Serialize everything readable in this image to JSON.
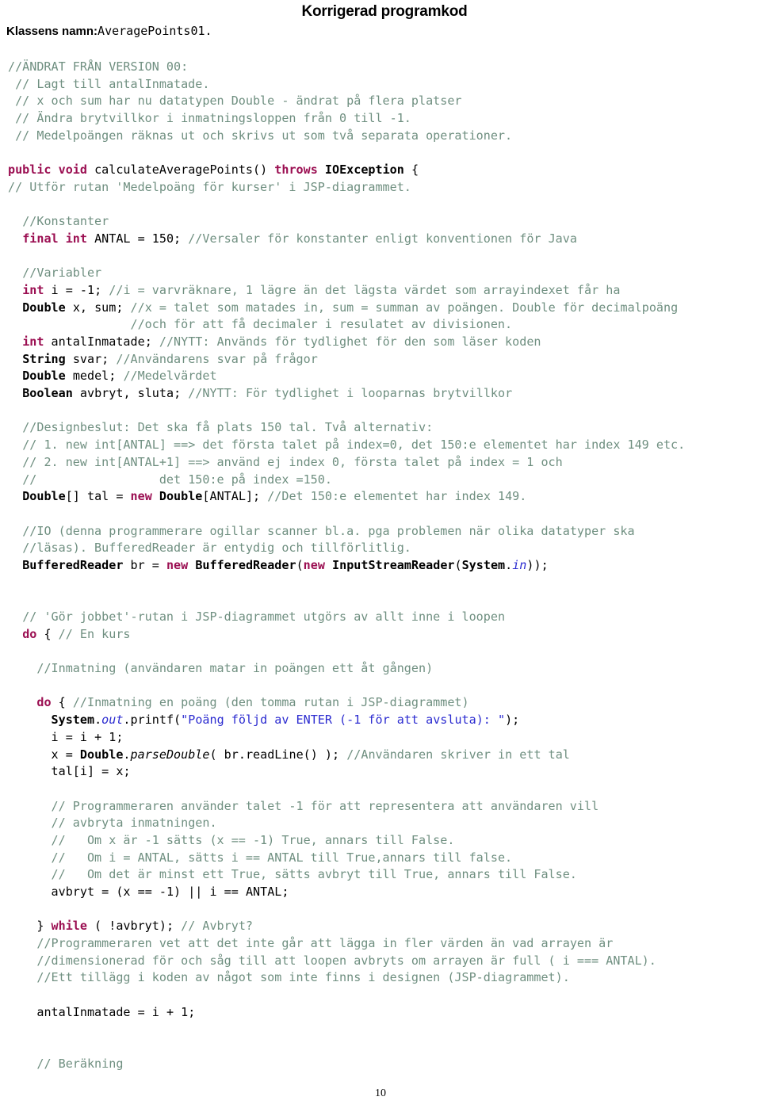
{
  "header": {
    "title": "Korrigerad programkod",
    "class_label": "Klassens namn:",
    "class_value": "AveragePoints01."
  },
  "footer": {
    "page_number": "10"
  },
  "colors": {
    "comment": "#6f8f80",
    "keyword": "#9b0f52",
    "string": "#2b2bd0",
    "text": "#000000",
    "background": "#ffffff"
  },
  "code": {
    "lines": [
      "//ÄNDRAT FRÅN VERSION 00:",
      " // Lagt till antalInmatade.",
      " // x och sum har nu datatypen Double - ändrat på flera platser",
      " // Ändra brytvillkor i inmatningsloppen från 0 till -1.",
      " // Medelpoängen räknas ut och skrivs ut som två separata operationer.",
      "",
      "public void calculateAveragePoints() throws IOException {",
      "// Utför rutan 'Medelpoäng för kurser' i JSP-diagrammet.",
      "",
      "  //Konstanter",
      "  final int ANTAL = 150; //Versaler för konstanter enligt konventionen för Java",
      "",
      "  //Variabler",
      "  int i = -1; //i = varvräknare, 1 lägre än det lägsta värdet som arrayindexet får ha",
      "  Double x, sum; //x = talet som matades in, sum = summan av poängen. Double för decimalpoäng",
      "                 //och för att få decimaler i resulatet av divisionen.",
      "  int antalInmatade; //NYTT: Används för tydlighet för den som läser koden",
      "  String svar; //Användarens svar på frågor",
      "  Double medel; //Medelvärdet",
      "  Boolean avbryt, sluta; //NYTT: För tydlighet i looparnas brytvillkor",
      "",
      "  //Designbeslut: Det ska få plats 150 tal. Två alternativ:",
      "  // 1. new int[ANTAL] ==> det första talet på index=0, det 150:e elementet har index 149 etc.",
      "  // 2. new int[ANTAL+1] ==> använd ej index 0, första talet på index = 1 och",
      "  //                 det 150:e på index =150.",
      "  Double[] tal = new Double[ANTAL]; //Det 150:e elementet har index 149.",
      "",
      "  //IO (denna programmerare ogillar scanner bl.a. pga problemen när olika datatyper ska",
      "  //läsas). BufferedReader är entydig och tillförlitlig.",
      "  BufferedReader br = new BufferedReader(new InputStreamReader(System.in));",
      "",
      "",
      "  // 'Gör jobbet'-rutan i JSP-diagrammet utgörs av allt inne i loopen",
      "  do { // En kurs",
      "",
      "    //Inmatning (användaren matar in poängen ett åt gången)",
      "",
      "    do { //Inmatning en poäng (den tomma rutan i JSP-diagrammet)",
      "      System.out.printf(\"Poäng följd av ENTER (-1 för att avsluta): \");",
      "      i = i + 1;",
      "      x = Double.parseDouble( br.readLine() ); //Användaren skriver in ett tal",
      "      tal[i] = x;",
      "",
      "      // Programmeraren använder talet -1 för att representera att användaren vill",
      "      // avbryta inmatningen.",
      "      //   Om x är -1 sätts (x == -1) True, annars till False.",
      "      //   Om i = ANTAL, sätts i == ANTAL till True,annars till false.",
      "      //   Om det är minst ett True, sätts avbryt till True, annars till False.",
      "      avbryt = (x == -1) || i == ANTAL;",
      "",
      "    } while ( !avbryt); // Avbryt?",
      "    //Programmeraren vet att det inte går att lägga in fler värden än vad arrayen är",
      "    //dimensionerad för och såg till att loopen avbryts om arrayen är full ( i === ANTAL).",
      "    //Ett tillägg i koden av något som inte finns i designen (JSP-diagrammet).",
      "",
      "    antalInmatade = i + 1;",
      "",
      "",
      "    // Beräkning"
    ]
  }
}
